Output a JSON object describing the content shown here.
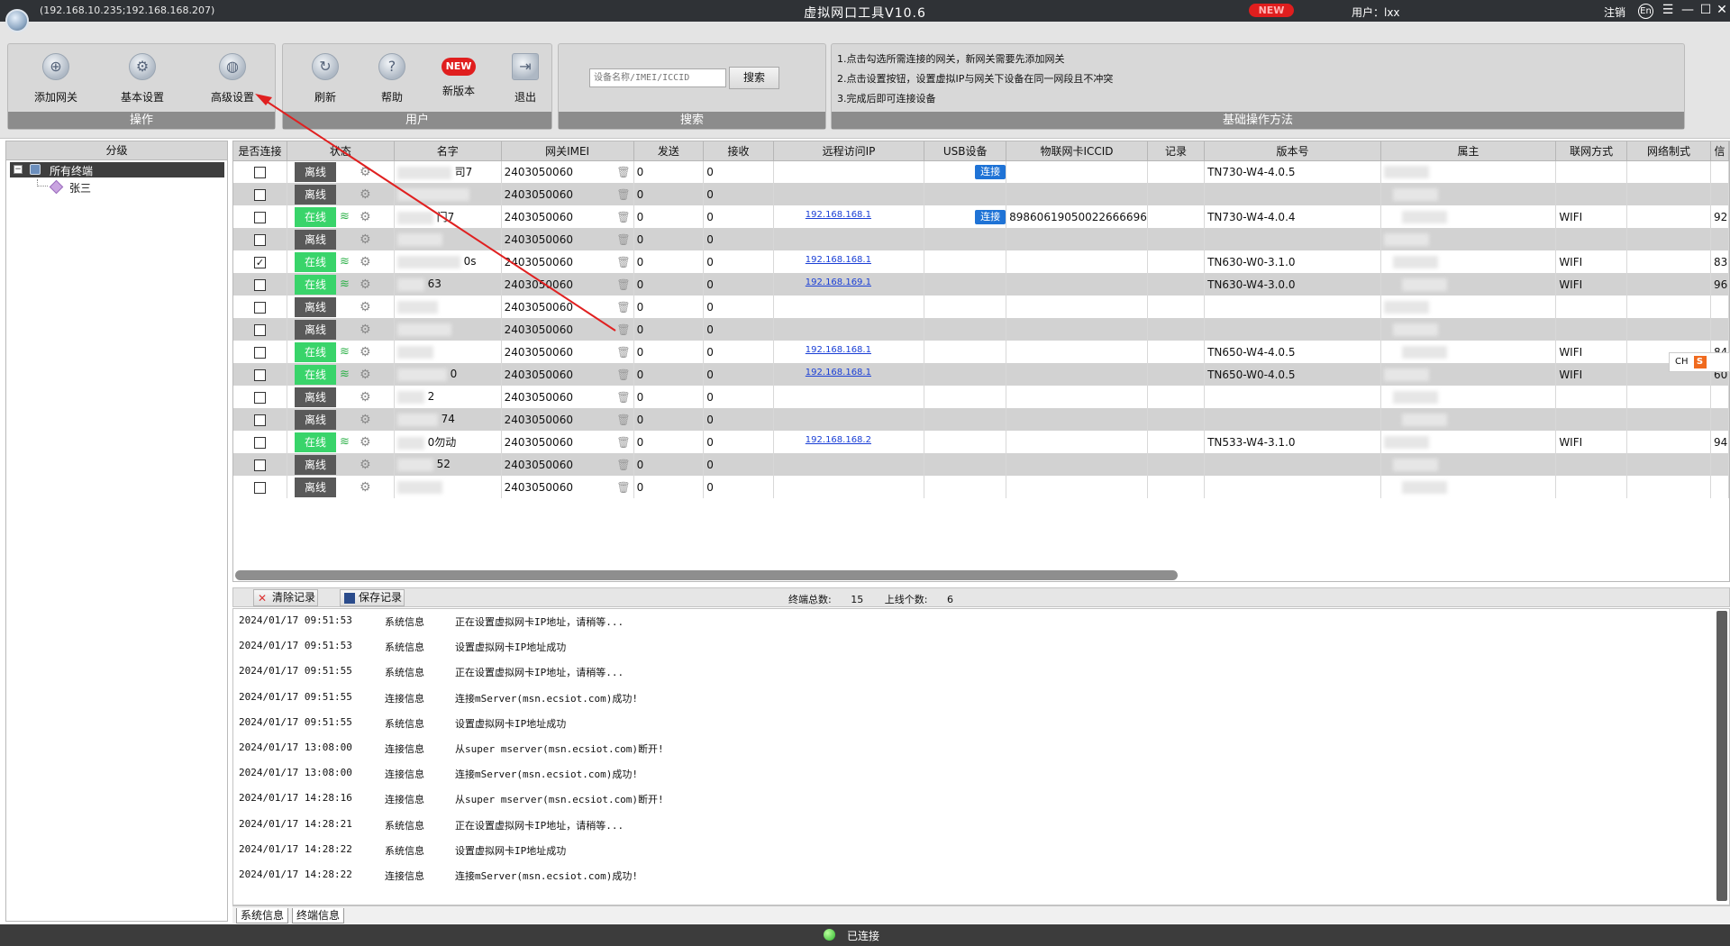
{
  "titlebar": {
    "ips": "(192.168.10.235;192.168.168.207)",
    "title": "虚拟网口工具V10.6",
    "new_badge": "NEW",
    "user": "用户：lxx",
    "logout": "注销",
    "lang": "En"
  },
  "toolbar": {
    "ops": {
      "label": "操作",
      "buttons": [
        "添加网关",
        "基本设置",
        "高级设置"
      ]
    },
    "user": {
      "label": "用户",
      "buttons": [
        "刷新",
        "帮助",
        "新版本",
        "退出"
      ],
      "new_icon": "NEW"
    },
    "search": {
      "label": "搜索",
      "placeholder": "设备名称/IMEI/ICCID",
      "button": "搜索"
    },
    "help": {
      "label": "基础操作方法",
      "lines": [
        "1.点击勾选所需连接的网关，新网关需要先添加网关",
        "2.点击设置按钮，设置虚拟IP与网关下设备在同一网段且不冲突",
        "3.完成后即可连接设备"
      ]
    }
  },
  "sidebar": {
    "header": "分级",
    "root": "所有终端",
    "child": "张三"
  },
  "grid": {
    "columns": [
      "是否连接",
      "状态",
      "名字",
      "网关IMEI",
      "发送",
      "接收",
      "远程访问IP",
      "USB设备",
      "物联网卡ICCID",
      "记录",
      "版本号",
      "属主",
      "联网方式",
      "网络制式",
      "信"
    ],
    "rows": [
      {
        "checked": false,
        "status": "离线",
        "online": false,
        "name": "司7",
        "imei": "2403050060",
        "send": "0",
        "recv": "0",
        "ip": "",
        "usb": "连接",
        "iccid": "",
        "version": "TN730-W4-4.0.5",
        "net": "",
        "sig": ""
      },
      {
        "checked": false,
        "status": "离线",
        "online": false,
        "name": "",
        "imei": "2403050060",
        "send": "0",
        "recv": "0",
        "ip": "",
        "usb": "",
        "iccid": "",
        "version": "",
        "net": "",
        "sig": ""
      },
      {
        "checked": false,
        "status": "在线",
        "online": true,
        "name": "门7",
        "imei": "2403050060",
        "send": "0",
        "recv": "0",
        "ip": "192.168.168.1",
        "usb": "连接",
        "iccid": "89860619050022666696",
        "version": "TN730-W4-4.0.4",
        "net": "WIFI",
        "sig": "92"
      },
      {
        "checked": false,
        "status": "离线",
        "online": false,
        "name": "",
        "imei": "2403050060",
        "send": "0",
        "recv": "0",
        "ip": "",
        "usb": "",
        "iccid": "",
        "version": "",
        "net": "",
        "sig": ""
      },
      {
        "checked": true,
        "status": "在线",
        "online": true,
        "name": "0s",
        "imei": "2403050060",
        "send": "0",
        "recv": "0",
        "ip": "192.168.168.1",
        "usb": "",
        "iccid": "",
        "version": "TN630-W0-3.1.0",
        "net": "WIFI",
        "sig": "83"
      },
      {
        "checked": false,
        "status": "在线",
        "online": true,
        "name": "63",
        "imei": "2403050060",
        "send": "0",
        "recv": "0",
        "ip": "192.168.169.1",
        "usb": "",
        "iccid": "",
        "version": "TN630-W4-3.0.0",
        "net": "WIFI",
        "sig": "96"
      },
      {
        "checked": false,
        "status": "离线",
        "online": false,
        "name": "",
        "imei": "2403050060",
        "send": "0",
        "recv": "0",
        "ip": "",
        "usb": "",
        "iccid": "",
        "version": "",
        "net": "",
        "sig": ""
      },
      {
        "checked": false,
        "status": "离线",
        "online": false,
        "name": "",
        "imei": "2403050060",
        "send": "0",
        "recv": "0",
        "ip": "",
        "usb": "",
        "iccid": "",
        "version": "",
        "net": "",
        "sig": ""
      },
      {
        "checked": false,
        "status": "在线",
        "online": true,
        "name": "",
        "imei": "2403050060",
        "send": "0",
        "recv": "0",
        "ip": "192.168.168.1",
        "usb": "",
        "iccid": "",
        "version": "TN650-W4-4.0.5",
        "net": "WIFI",
        "sig": "84"
      },
      {
        "checked": false,
        "status": "在线",
        "online": true,
        "name": "0",
        "imei": "2403050060",
        "send": "0",
        "recv": "0",
        "ip": "192.168.168.1",
        "usb": "",
        "iccid": "",
        "version": "TN650-W0-4.0.5",
        "net": "WIFI",
        "sig": "60"
      },
      {
        "checked": false,
        "status": "离线",
        "online": false,
        "name": "2",
        "imei": "2403050060",
        "send": "0",
        "recv": "0",
        "ip": "",
        "usb": "",
        "iccid": "",
        "version": "",
        "net": "",
        "sig": ""
      },
      {
        "checked": false,
        "status": "离线",
        "online": false,
        "name": "74",
        "imei": "2403050060",
        "send": "0",
        "recv": "0",
        "ip": "",
        "usb": "",
        "iccid": "",
        "version": "",
        "net": "",
        "sig": ""
      },
      {
        "checked": false,
        "status": "在线",
        "online": true,
        "name": "0勿动",
        "imei": "2403050060",
        "send": "0",
        "recv": "0",
        "ip": "192.168.168.2",
        "usb": "",
        "iccid": "",
        "version": "TN533-W4-3.1.0",
        "net": "WIFI",
        "sig": "94"
      },
      {
        "checked": false,
        "status": "离线",
        "online": false,
        "name": "52",
        "imei": "2403050060",
        "send": "0",
        "recv": "0",
        "ip": "",
        "usb": "",
        "iccid": "",
        "version": "",
        "net": "",
        "sig": ""
      },
      {
        "checked": false,
        "status": "离线",
        "online": false,
        "name": "",
        "imei": "2403050060",
        "send": "0",
        "recv": "0",
        "ip": "",
        "usb": "",
        "iccid": "",
        "version": "",
        "net": "",
        "sig": ""
      }
    ]
  },
  "logbar": {
    "clear": "清除记录",
    "save": "保存记录",
    "total_label": "终端总数:",
    "total": "15",
    "online_label": "上线个数:",
    "online": "6"
  },
  "logs": [
    {
      "time": "2024/01/17 09:51:53",
      "type": "系统信息",
      "msg": "正在设置虚拟网卡IP地址，请稍等..."
    },
    {
      "time": "2024/01/17 09:51:53",
      "type": "系统信息",
      "msg": "设置虚拟网卡IP地址成功"
    },
    {
      "time": "2024/01/17 09:51:55",
      "type": "系统信息",
      "msg": "正在设置虚拟网卡IP地址，请稍等..."
    },
    {
      "time": "2024/01/17 09:51:55",
      "type": "连接信息",
      "msg": "连接mServer(msn.ecsiot.com)成功!"
    },
    {
      "time": "2024/01/17 09:51:55",
      "type": "系统信息",
      "msg": "设置虚拟网卡IP地址成功"
    },
    {
      "time": "2024/01/17 13:08:00",
      "type": "连接信息",
      "msg": "从super mserver(msn.ecsiot.com)断开!"
    },
    {
      "time": "2024/01/17 13:08:00",
      "type": "连接信息",
      "msg": "连接mServer(msn.ecsiot.com)成功!"
    },
    {
      "time": "2024/01/17 14:28:16",
      "type": "连接信息",
      "msg": "从super mserver(msn.ecsiot.com)断开!"
    },
    {
      "time": "2024/01/17 14:28:21",
      "type": "系统信息",
      "msg": "正在设置虚拟网卡IP地址，请稍等..."
    },
    {
      "time": "2024/01/17 14:28:22",
      "type": "系统信息",
      "msg": "设置虚拟网卡IP地址成功"
    },
    {
      "time": "2024/01/17 14:28:22",
      "type": "连接信息",
      "msg": "连接mServer(msn.ecsiot.com)成功!"
    }
  ],
  "logtabs": [
    "系统信息",
    "终端信息"
  ],
  "status": {
    "text": "已连接"
  },
  "ime": {
    "label": "CH",
    "badge": "S"
  }
}
